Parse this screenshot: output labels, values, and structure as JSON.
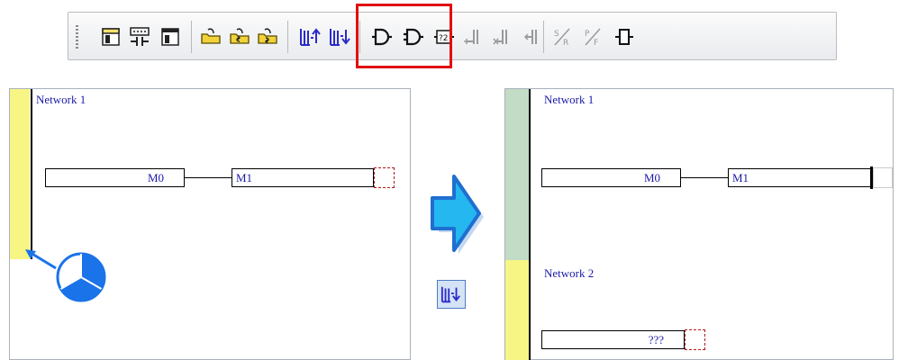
{
  "toolbar": {
    "buttons": [
      {
        "name": "new-diagram-icon"
      },
      {
        "name": "contact-instruction-icon"
      },
      {
        "name": "window-icon"
      },
      {
        "name": "open-folder-icon"
      },
      {
        "name": "folder-up-icon"
      },
      {
        "name": "folder-down-icon"
      },
      {
        "name": "insert-network-above-icon"
      },
      {
        "name": "insert-network-below-icon"
      },
      {
        "name": "and-gate-icon"
      },
      {
        "name": "or-gate-icon"
      },
      {
        "name": "compare-box-icon"
      },
      {
        "name": "parallel-branch-icon"
      },
      {
        "name": "branch-x-icon"
      },
      {
        "name": "branch-left-icon"
      },
      {
        "name": "set-reset-icon"
      },
      {
        "name": "pulse-falling-icon"
      },
      {
        "name": "coil-box-icon"
      }
    ]
  },
  "left_panel": {
    "network_label": "Network 1",
    "contact1": "M0",
    "contact2": "M1"
  },
  "right_panel": {
    "network1_label": "Network 1",
    "contact1": "M0",
    "contact2": "M1",
    "network2_label": "Network 2",
    "placeholder": "???"
  },
  "colors": {
    "accent_blue": "#1a73e8",
    "highlight_red": "#e01010",
    "sidebar_yellow": "#f7f584",
    "sidebar_green": "#c2dcc6"
  }
}
